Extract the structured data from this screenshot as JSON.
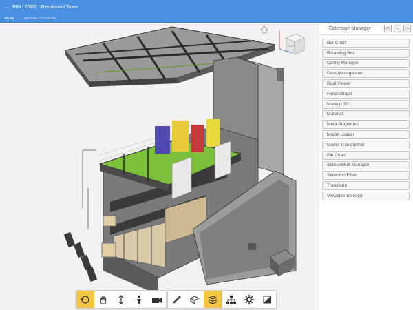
{
  "header": {
    "title": "BIM / DWG - Residential Tower",
    "tabs": [
      {
        "label": "FILES",
        "active": true
      },
      {
        "label": "RECENT ACTIVITIES",
        "active": false
      }
    ]
  },
  "panel": {
    "title": "Extension Manager",
    "items": [
      "Bar Chart",
      "Bounding Box",
      "Config Manager",
      "Data Management",
      "Dual Viewer",
      "Force Graph",
      "Markup 3D",
      "Material",
      "Meta Properties",
      "Model Loader",
      "Model Transformer",
      "Pie Chart",
      "ScreenShot Manager",
      "Selection Filter",
      "Transform",
      "Viewable Selector"
    ]
  },
  "viewcube": {
    "face_label": "FRONT"
  },
  "theme": {
    "accent": "#4a90e2",
    "active_tool": "#f4c542"
  },
  "toolbar": {
    "group1": [
      "orbit-icon",
      "pan-icon",
      "zoom-icon",
      "first-person-icon",
      "camera-icon"
    ],
    "group2": [
      "measure-icon",
      "section-icon",
      "explode-icon"
    ],
    "group3": [
      "model-browser-icon",
      "settings-icon",
      "fullscreen-icon"
    ],
    "active": [
      "orbit-icon",
      "explode-icon"
    ]
  }
}
